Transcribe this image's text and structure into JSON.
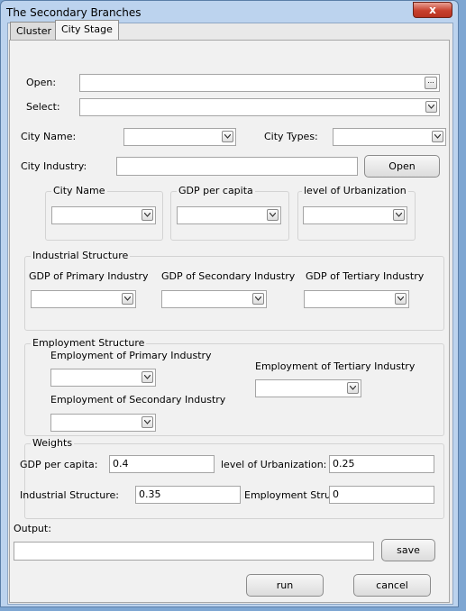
{
  "window": {
    "title": "The Secondary Branches",
    "close_label": "x"
  },
  "tabs": [
    {
      "label": "Cluster"
    },
    {
      "label": "City Stage"
    }
  ],
  "form": {
    "open_label": "Open:",
    "open_value": "",
    "open_browse": "...",
    "select_label": "Select:",
    "select_value": "",
    "city_name_label": "City Name:",
    "city_name_value": "",
    "city_types_label": "City Types:",
    "city_types_value": "",
    "city_industry_label": "City Industry:",
    "city_industry_value": "",
    "open_button": "Open"
  },
  "city_groups": {
    "city_name": {
      "legend": "City Name",
      "value": ""
    },
    "gdp_per_capita": {
      "legend": "GDP per capita",
      "value": ""
    },
    "urbanization": {
      "legend": "level of Urbanization",
      "value": ""
    }
  },
  "industrial_structure": {
    "legend": "Industrial Structure",
    "primary_label": "GDP of Primary Industry",
    "secondary_label": "GDP of Secondary Industry",
    "tertiary_label": "GDP of Tertiary Industry"
  },
  "employment_structure": {
    "legend": "Employment Structure",
    "primary_label": "Employment of Primary Industry",
    "tertiary_label": "Employment of Tertiary Industry",
    "secondary_label": "Employment of Secondary Industry"
  },
  "weights": {
    "legend": "Weights",
    "gdp_label": "GDP per capita:",
    "gdp_value": "0.4",
    "urbanization_label": "level of Urbanization:",
    "urbanization_value": "0.25",
    "industrial_label": "Industrial Structure:",
    "industrial_value": "0.35",
    "employment_label": "Employment Structure:",
    "employment_value": "0"
  },
  "output": {
    "label": "Output:",
    "value": "",
    "save_button": "save"
  },
  "actions": {
    "run": "run",
    "cancel": "cancel"
  },
  "icons": {
    "dropdown": "chevron-down-icon",
    "browse": "ellipsis-icon",
    "close": "close-icon"
  }
}
